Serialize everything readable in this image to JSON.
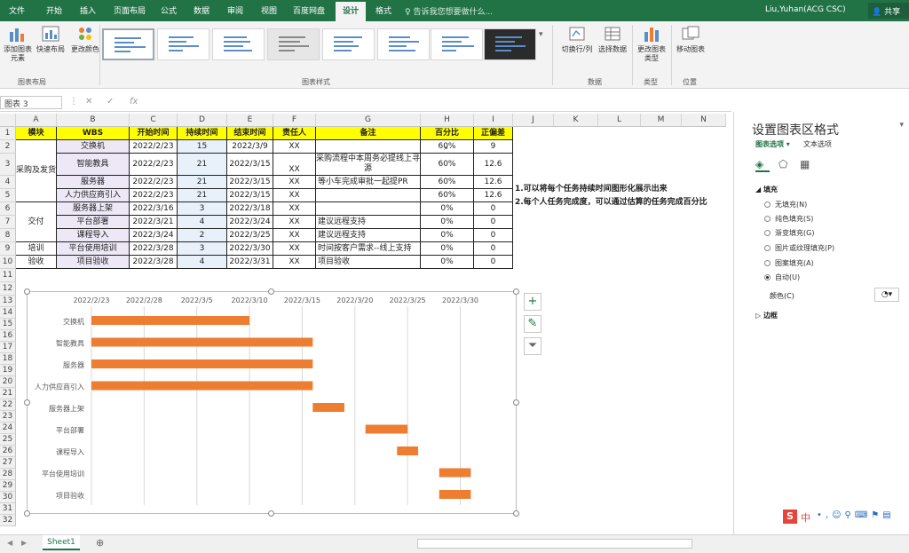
{
  "titlebar": {
    "tabs": [
      "文件",
      "开始",
      "插入",
      "页面布局",
      "公式",
      "数据",
      "审阅",
      "视图",
      "百度网盘",
      "设计",
      "格式"
    ],
    "active_tab": "设计",
    "tell_me": "告诉我您想要做什么...",
    "user": "Liu,Yuhan(ACG CSC)",
    "share": "共享"
  },
  "ribbon": {
    "add_element": "添加图表元素",
    "quick_layout": "快速布局",
    "change_colors": "更改颜色",
    "group_layout": "图表布局",
    "group_styles": "图表样式",
    "switch_row_col": "切换行/列",
    "select_data": "选择数据",
    "group_data": "数据",
    "change_type": "更改图表类型",
    "group_type": "类型",
    "move_chart": "移动图表",
    "group_location": "位置"
  },
  "formula_bar": {
    "name_box": "图表 3",
    "fx": "fx",
    "value": ""
  },
  "columns": [
    "A",
    "B",
    "C",
    "D",
    "E",
    "F",
    "G",
    "H",
    "I",
    "J",
    "K",
    "L",
    "M",
    "N"
  ],
  "rows": [
    "1",
    "2",
    "3",
    "4",
    "5",
    "6",
    "7",
    "8",
    "9",
    "10",
    "11",
    "12",
    "13",
    "14",
    "15",
    "16",
    "17",
    "18",
    "19",
    "20",
    "21",
    "22",
    "23",
    "24",
    "25",
    "26",
    "27",
    "28",
    "29",
    "30",
    "31",
    "32"
  ],
  "table": {
    "headers": [
      "模块",
      "WBS",
      "开始时间",
      "持续时间",
      "结束时间",
      "责任人",
      "备注",
      "百分比",
      "正偏差"
    ],
    "modules": [
      "采购及发货",
      "交付",
      "培训",
      "验收"
    ],
    "rows": [
      [
        "交换机",
        "2022/2/23",
        "15",
        "2022/3/9",
        "XX",
        "",
        "60%",
        "9"
      ],
      [
        "智能教具",
        "2022/2/23",
        "21",
        "2022/3/15",
        "XX",
        "采购流程中本周务必提线上寻源",
        "60%",
        "12.6"
      ],
      [
        "服务器",
        "2022/2/23",
        "21",
        "2022/3/15",
        "XX",
        "等小车完成审批一起提PR",
        "60%",
        "12.6"
      ],
      [
        "人力供应商引入",
        "2022/2/23",
        "21",
        "2022/3/15",
        "XX",
        "",
        "60%",
        "12.6"
      ],
      [
        "服务器上架",
        "2022/3/16",
        "3",
        "2022/3/18",
        "XX",
        "",
        "0%",
        "0"
      ],
      [
        "平台部署",
        "2022/3/21",
        "4",
        "2022/3/24",
        "XX",
        "建议远程支持",
        "0%",
        "0"
      ],
      [
        "课程导入",
        "2022/3/24",
        "2",
        "2022/3/25",
        "XX",
        "建议远程支持",
        "0%",
        "0"
      ],
      [
        "平台使用培训",
        "2022/3/28",
        "3",
        "2022/3/30",
        "XX",
        "时间按客户需求--线上支持",
        "0%",
        "0"
      ],
      [
        "项目验收",
        "2022/3/28",
        "4",
        "2022/3/31",
        "XX",
        "项目验收",
        "0%",
        "0"
      ]
    ]
  },
  "notes": [
    "1.可以将每个任务持续时间图形化展示出来",
    "2.每个人任务完成度，可以通过估算的任务完成百分比"
  ],
  "chart_data": {
    "type": "bar",
    "orientation": "horizontal",
    "stacked": true,
    "categories": [
      "交换机",
      "智能教具",
      "服务器",
      "人力供应商引入",
      "服务器上架",
      "平台部署",
      "课程导入",
      "平台使用培训",
      "项目验收"
    ],
    "start": [
      "2022/2/23",
      "2022/2/23",
      "2022/2/23",
      "2022/2/23",
      "2022/3/16",
      "2022/3/21",
      "2022/3/24",
      "2022/3/28",
      "2022/3/28"
    ],
    "duration": [
      15,
      21,
      21,
      21,
      3,
      4,
      2,
      3,
      3
    ],
    "x_ticks": [
      "2022/2/23",
      "2022/2/28",
      "2022/3/5",
      "2022/3/10",
      "2022/3/15",
      "2022/3/20",
      "2022/3/25",
      "2022/3/30"
    ],
    "xlim": [
      "2022/2/23",
      "2022/4/3"
    ],
    "x_axis_position": "top",
    "bar_color": "#ed7d31",
    "grid": true
  },
  "taskpane": {
    "title": "设置图表区格式",
    "tab_chart": "图表选项",
    "tab_text": "文本选项",
    "fill_section": "填充",
    "fill_options": [
      "无填充(N)",
      "纯色填充(S)",
      "渐变填充(G)",
      "图片或纹理填充(P)",
      "图案填充(A)",
      "自动(U)"
    ],
    "selected_fill": "自动(U)",
    "color_label": "颜色(C)",
    "border_section": "边框"
  },
  "ime": {
    "label": "中"
  },
  "sheet": {
    "tab": "Sheet1"
  }
}
